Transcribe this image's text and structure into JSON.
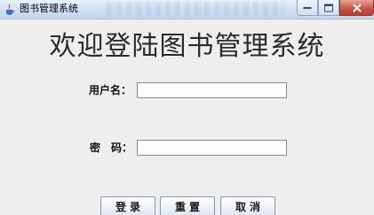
{
  "window": {
    "title": "图书管理系统"
  },
  "main": {
    "heading": "欢迎登陆图书管理系统",
    "username_label": "用户名：",
    "password_label": "密　码：",
    "username_value": "",
    "password_value": ""
  },
  "buttons": {
    "login": "登录",
    "reset": "重置",
    "cancel": "取消"
  },
  "icons": {
    "app": "java-coffee-cup-icon",
    "minimize": "minimize-icon",
    "maximize": "maximize-icon",
    "close": "close-icon"
  },
  "colors": {
    "close_button": "#c7503f",
    "titlebar": "#cfe0f3",
    "background": "#eeeeee"
  }
}
